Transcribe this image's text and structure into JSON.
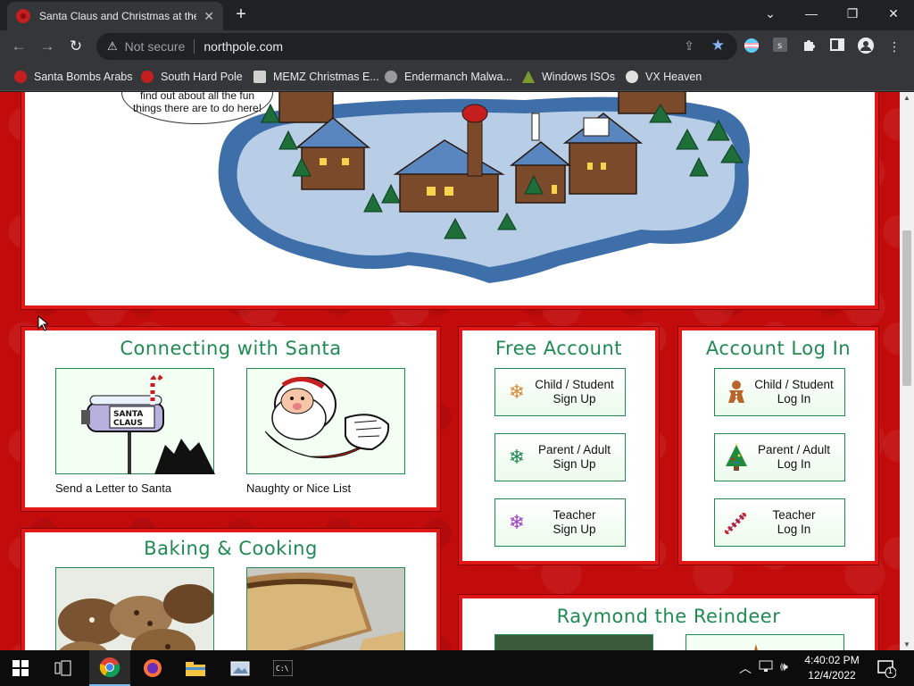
{
  "browser": {
    "tab_title": "Santa Claus and Christmas at the",
    "tab_close": "✕",
    "new_tab": "+",
    "window_controls": [
      "⌄",
      "—",
      "❐",
      "✕"
    ],
    "nav": {
      "back": "←",
      "forward": "→",
      "reload": "↻"
    },
    "security_label": "Not secure",
    "url": "northpole.com",
    "bookmarks": [
      {
        "label": "Santa Bombs Arabs",
        "color": "#c41e1e"
      },
      {
        "label": "South Hard Pole",
        "color": "#c41e1e"
      },
      {
        "label": "MEMZ Christmas E...",
        "color": "#d0d0d0"
      },
      {
        "label": "Endermanch Malwa...",
        "color": "#9a9a9a"
      },
      {
        "label": "Windows ISOs",
        "color": "#7a9a2e"
      },
      {
        "label": "VX Heaven",
        "color": "#e0e0e0"
      }
    ]
  },
  "page": {
    "hero_bubble_text": [
      "find out about all the fun",
      "things there are to do here!"
    ],
    "connecting": {
      "title": "Connecting with Santa",
      "cards": [
        {
          "caption": "Send a Letter to Santa",
          "mailbox_text": [
            "SANTA",
            "CLAUS"
          ]
        },
        {
          "caption": "Naughty or Nice List"
        }
      ]
    },
    "free_account": {
      "title": "Free Account",
      "buttons": [
        {
          "line1": "Child / Student",
          "line2": "Sign Up",
          "icon": "snowflake-orange-icon"
        },
        {
          "line1": "Parent / Adult",
          "line2": "Sign Up",
          "icon": "snowflake-green-icon"
        },
        {
          "line1": "Teacher",
          "line2": "Sign Up",
          "icon": "snowflake-purple-icon"
        }
      ]
    },
    "account_login": {
      "title": "Account Log In",
      "buttons": [
        {
          "line1": "Child / Student",
          "line2": "Log In",
          "icon": "gingerbread-icon"
        },
        {
          "line1": "Parent / Adult",
          "line2": "Log In",
          "icon": "christmas-tree-icon"
        },
        {
          "line1": "Teacher",
          "line2": "Log In",
          "icon": "candy-cane-icon"
        }
      ]
    },
    "baking": {
      "title": "Baking & Cooking"
    },
    "reindeer": {
      "title": "Raymond the Reindeer"
    }
  },
  "taskbar": {
    "time": "4:40:02 PM",
    "date": "12/4/2022",
    "notification_count": "1"
  }
}
